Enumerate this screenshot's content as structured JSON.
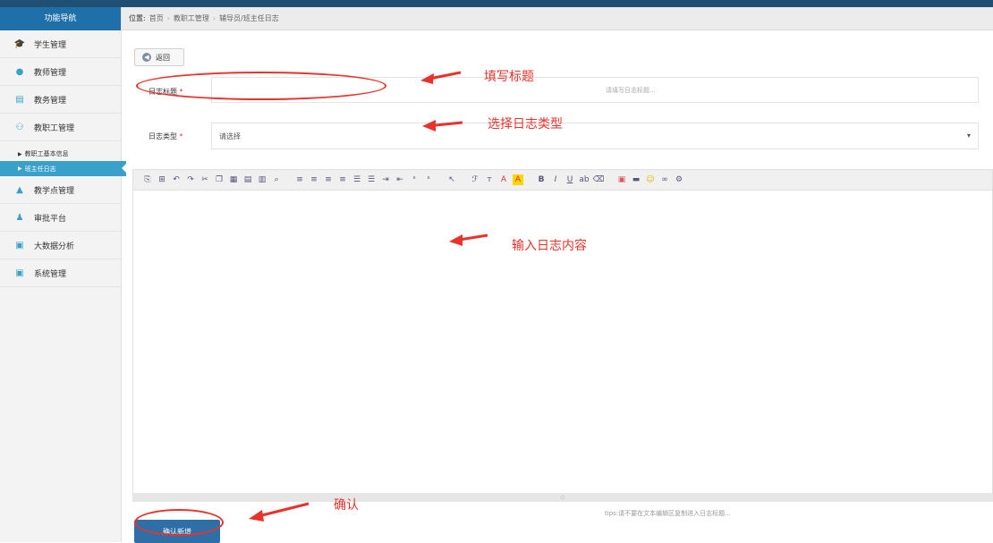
{
  "sidebar": {
    "header": "功能导航",
    "items": [
      {
        "label": "学生管理",
        "icon": "graduation-cap-icon"
      },
      {
        "label": "教师管理",
        "icon": "person-icon"
      },
      {
        "label": "教务管理",
        "icon": "printer-icon"
      },
      {
        "label": "教职工管理",
        "icon": "people-icon"
      }
    ],
    "subitems": [
      {
        "label": "教职工基本信息"
      },
      {
        "label": "班主任日志"
      }
    ],
    "items2": [
      {
        "label": "教学点管理",
        "icon": "building-icon"
      },
      {
        "label": "审批平台",
        "icon": "person-icon"
      },
      {
        "label": "大数据分析",
        "icon": "monitor-icon"
      },
      {
        "label": "系统管理",
        "icon": "monitor-icon"
      }
    ]
  },
  "breadcrumb": {
    "prefix": "位置:",
    "items": [
      "首页",
      "教职工管理",
      "辅导员/班主任日志"
    ]
  },
  "back_button": {
    "label": "返回"
  },
  "form": {
    "title_label": "日志标题",
    "title_required": "*",
    "title_placeholder": "请填写日志标题...",
    "type_label": "日志类型",
    "type_required": "*",
    "type_value": "请选择"
  },
  "editor": {
    "footer_glyph": "◇",
    "tip": "tips:请不要在文本编辑区复制进入日志标题..."
  },
  "confirm_button": {
    "label": "确认新增"
  },
  "annotations": {
    "title": "填写标题",
    "type": "选择日志类型",
    "content": "输入日志内容",
    "confirm": "确认",
    "color": "#e8322a"
  },
  "colors": {
    "sidebar_header": "#1f6fa8",
    "active_item": "#38a0c9",
    "confirm_button": "#2e6fa8"
  }
}
